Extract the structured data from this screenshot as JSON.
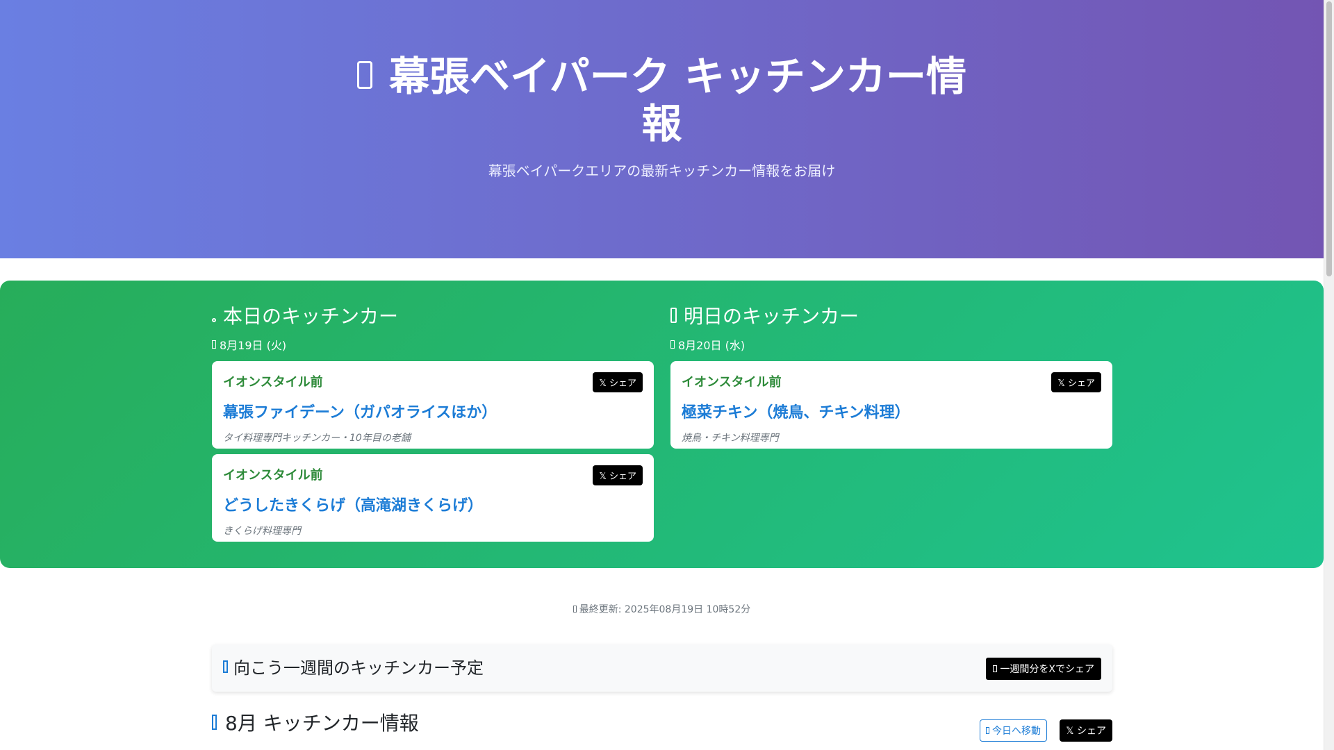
{
  "hero": {
    "title": "幕張ベイパーク キッチンカー情報",
    "subtitle": "幕張ベイパークエリアの最新キッチンカー情報をお届け",
    "icon": "truck-icon"
  },
  "today": {
    "heading": "本日のキッチンカー",
    "date": "8月19日 (火)",
    "items": [
      {
        "location": "イオンスタイル前",
        "name": "幕張ファイデーン（ガパオライスほか）",
        "desc": "タイ料理専門キッチンカー・10年目の老舗",
        "share": "𝕏 シェア"
      },
      {
        "location": "イオンスタイル前",
        "name": "どうしたきくらげ（高滝湖きくらげ）",
        "desc": "きくらげ料理専門",
        "share": "𝕏 シェア"
      }
    ]
  },
  "tomorrow": {
    "heading": "明日のキッチンカー",
    "date": "8月20日 (水)",
    "items": [
      {
        "location": "イオンスタイル前",
        "name": "極菜チキン（焼鳥、チキン料理）",
        "desc": "焼鳥・チキン料理専門",
        "share": "𝕏 シェア"
      }
    ]
  },
  "updated": "最終更新: 2025年08月19日 10時52分",
  "week": {
    "heading": "向こう一週間のキッチンカー予定",
    "share": "一週間分をXでシェア"
  },
  "month": {
    "heading": "8月 キッチンカー情報",
    "today_button": "今日へ移動",
    "share": "𝕏 シェア"
  },
  "colors": {
    "hero_start": "#6a7fe2",
    "hero_end": "#7355b3",
    "green_start": "#27ad5a",
    "green_end": "#1fc38f",
    "location": "#2e8b3a",
    "name_link": "#1c7cd6"
  }
}
